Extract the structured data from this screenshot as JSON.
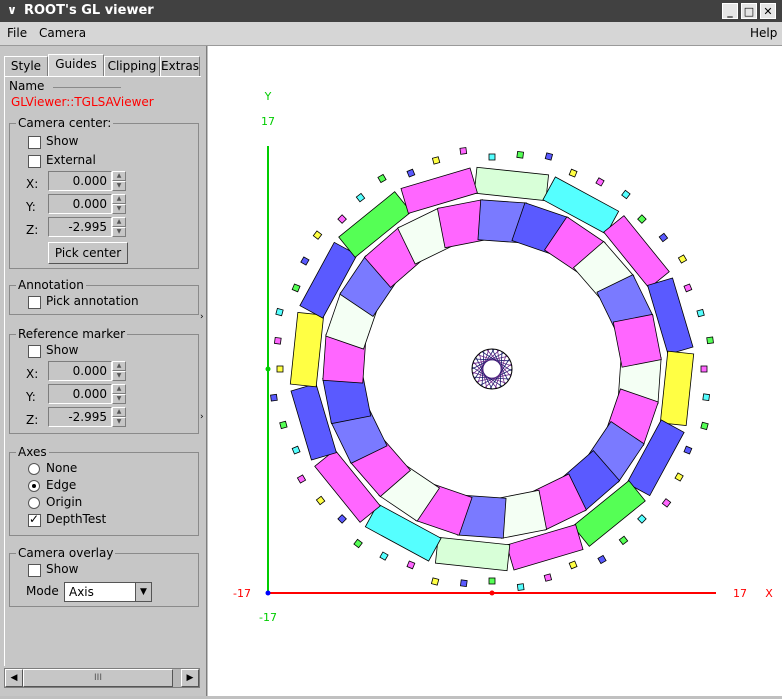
{
  "window": {
    "title": "ROOT's GL viewer",
    "minimize_glyph": "_",
    "maximize_glyph": "□",
    "close_glyph": "✕",
    "menu_glyph": "∨"
  },
  "menubar": {
    "file": "File",
    "camera": "Camera",
    "help": "Help"
  },
  "tabs": [
    {
      "label": "Style",
      "active": false
    },
    {
      "label": "Guides",
      "active": true
    },
    {
      "label": "Clipping",
      "active": false
    },
    {
      "label": "Extras",
      "active": false
    }
  ],
  "guides": {
    "name_label": "Name",
    "name_value": "GLViewer::TGLSAViewer",
    "camera_center": {
      "title": "Camera center:",
      "show_label": "Show",
      "show_checked": false,
      "external_label": "External",
      "external_checked": false,
      "x_label": "X:",
      "x_value": "0.000",
      "y_label": "Y:",
      "y_value": "0.000",
      "z_label": "Z:",
      "z_value": "-2.995",
      "pick_center_label": "Pick center"
    },
    "annotation": {
      "title": "Annotation",
      "pick_annotation_label": "Pick annotation",
      "pick_annotation_checked": false
    },
    "reference_marker": {
      "title": "Reference marker",
      "show_label": "Show",
      "show_checked": false,
      "x_label": "X:",
      "x_value": "0.000",
      "y_label": "Y:",
      "y_value": "0.000",
      "z_label": "Z:",
      "z_value": "-2.995"
    },
    "axes": {
      "title": "Axes",
      "none_label": "None",
      "edge_label": "Edge",
      "origin_label": "Origin",
      "selected": "Edge",
      "depthtest_label": "DepthTest",
      "depthtest_checked": true
    },
    "camera_overlay": {
      "title": "Camera overlay",
      "show_label": "Show",
      "show_checked": false,
      "mode_label": "Mode",
      "mode_value": "Axis"
    }
  },
  "scroll": {
    "left_glyph": "◀",
    "right_glyph": "▶",
    "thumb_glyph": "III"
  },
  "viewer": {
    "y_axis_label": "Y",
    "x_axis_label": "X",
    "y_top_tick": "17",
    "y_bottom_tick": "-17",
    "x_left_tick": "-17",
    "x_right_tick": "17",
    "y_axis_color": "#00cc00",
    "x_axis_color": "#ff0000"
  },
  "colors": {
    "magenta": "#ff66ff",
    "blue": "#5a5aff",
    "light_blue": "#7a7aff",
    "cyan": "#55ffff",
    "green": "#55ff55",
    "yellow": "#ffff44",
    "light_green": "#d8ffd8",
    "pale": "#f4fff4"
  }
}
